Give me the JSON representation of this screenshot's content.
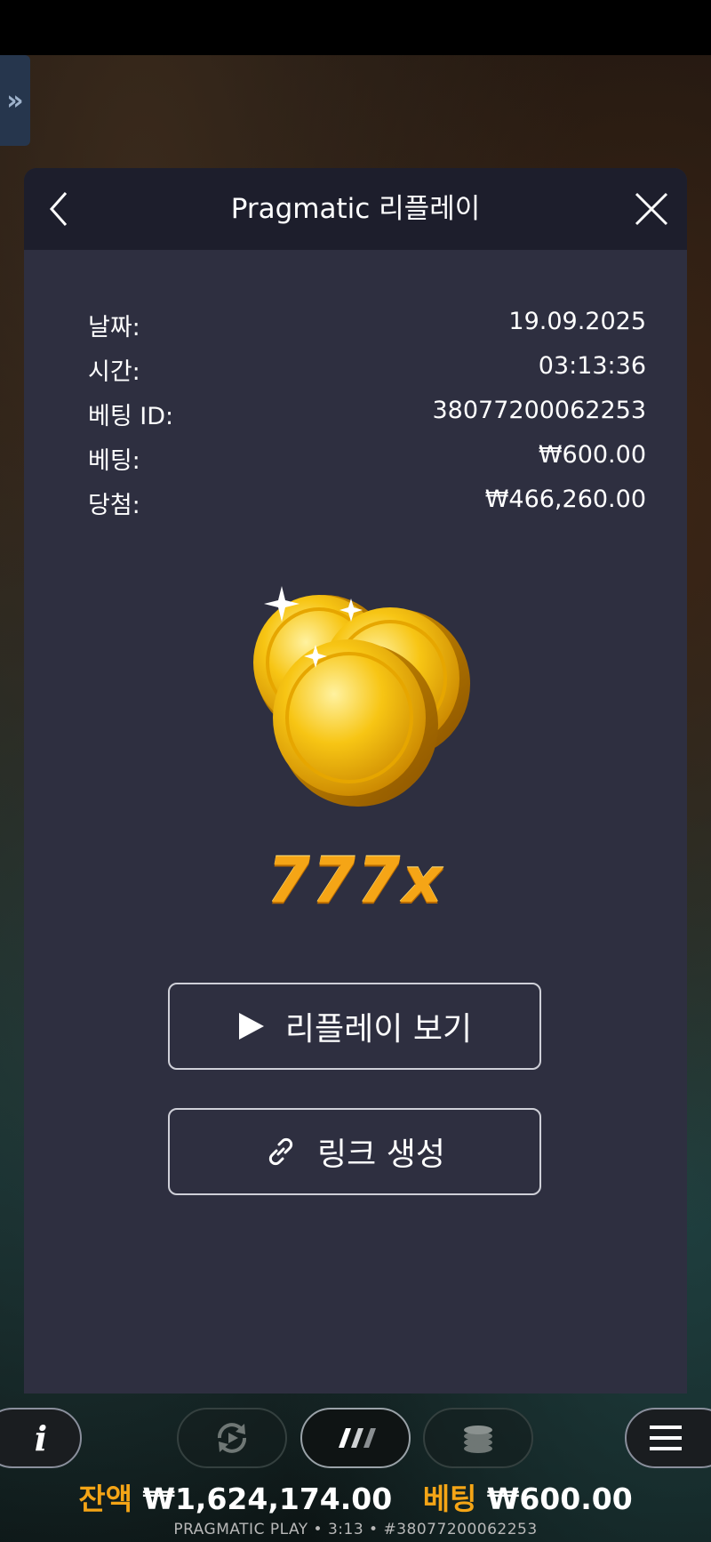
{
  "header": {
    "title": "Pragmatic 리플레이",
    "back_icon": "chevron-left-icon",
    "close_icon": "close-icon"
  },
  "details": {
    "date_label": "날짜:",
    "date_value": "19.09.2025",
    "time_label": "시간:",
    "time_value": "03:13:36",
    "bet_id_label": "베팅 ID:",
    "bet_id_value": "38077200062253",
    "bet_label": "베팅:",
    "bet_value": "₩600.00",
    "win_label": "당첨:",
    "win_value": "₩466,260.00"
  },
  "win": {
    "image": "gold-coins",
    "multiplier": "777x"
  },
  "actions": {
    "watch_replay_label": "리플레이 보기",
    "create_link_label": "링크 생성"
  },
  "bottom_bar": {
    "info_icon": "info-icon",
    "autoplay_icon": "autoplay-icon",
    "turbo_icon": "turbo-icon",
    "coins_icon": "coins-icon",
    "menu_icon": "menu-icon",
    "balance_label": "잔액",
    "balance_value": "₩1,624,174.00",
    "bet_label": "베팅",
    "bet_value": "₩600.00",
    "footer": "PRAGMATIC PLAY • 3:13 • #38077200062253"
  },
  "colors": {
    "panel_bg": "#2e2f40",
    "header_bg": "#1d1e2c",
    "accent_gold": "#f5a516"
  }
}
